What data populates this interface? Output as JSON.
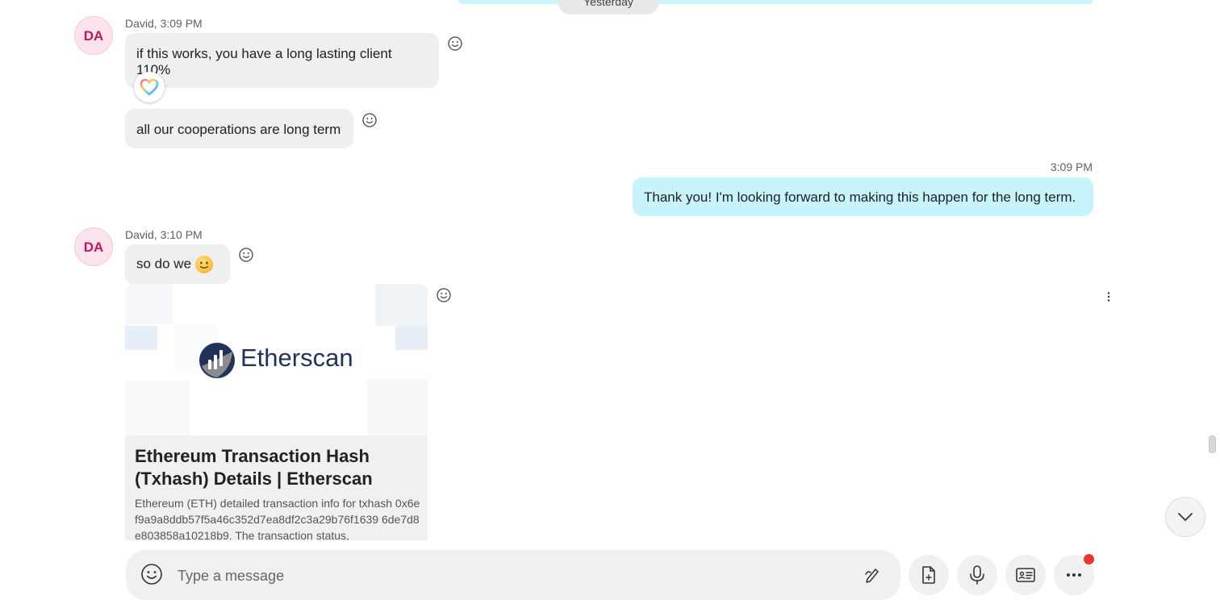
{
  "date_divider": "Yesterday",
  "messages": [
    {
      "avatar": "DA",
      "meta": "David, 3:09 PM",
      "text": "if this works, you have a long lasting client 110%"
    },
    {
      "text": "all our cooperations are long term"
    },
    {
      "meta": "3:09 PM",
      "text": "Thank you! I'm looking forward to making this happen for the long term."
    },
    {
      "avatar": "DA",
      "meta": "David, 3:10 PM",
      "text": "so do we"
    }
  ],
  "link_preview": {
    "brand": "Etherscan",
    "title": "Ethereum Transaction Hash (Txhash) Details | Etherscan",
    "description": "Ethereum (ETH) detailed transaction info for txhash 0x6ef9a9a8ddb57f5a46c352d7ea8df2c3a29b76f1639 6de7d8e803858a10218b9. The transaction status,"
  },
  "composer": {
    "placeholder": "Type a message"
  },
  "colors": {
    "incoming_bubble": "#efefef",
    "outgoing_bubble": "#c7f3fa",
    "avatar_text": "#c2185b",
    "notification_dot": "#e8382b"
  },
  "icons": [
    "emoji-react-icon",
    "heart-reaction-icon",
    "smiley-emoji-icon",
    "more-vertical-icon",
    "chevron-down-icon",
    "emoji-icon",
    "pen-icon",
    "file-icon",
    "microphone-icon",
    "contact-card-icon",
    "more-horizontal-icon"
  ]
}
